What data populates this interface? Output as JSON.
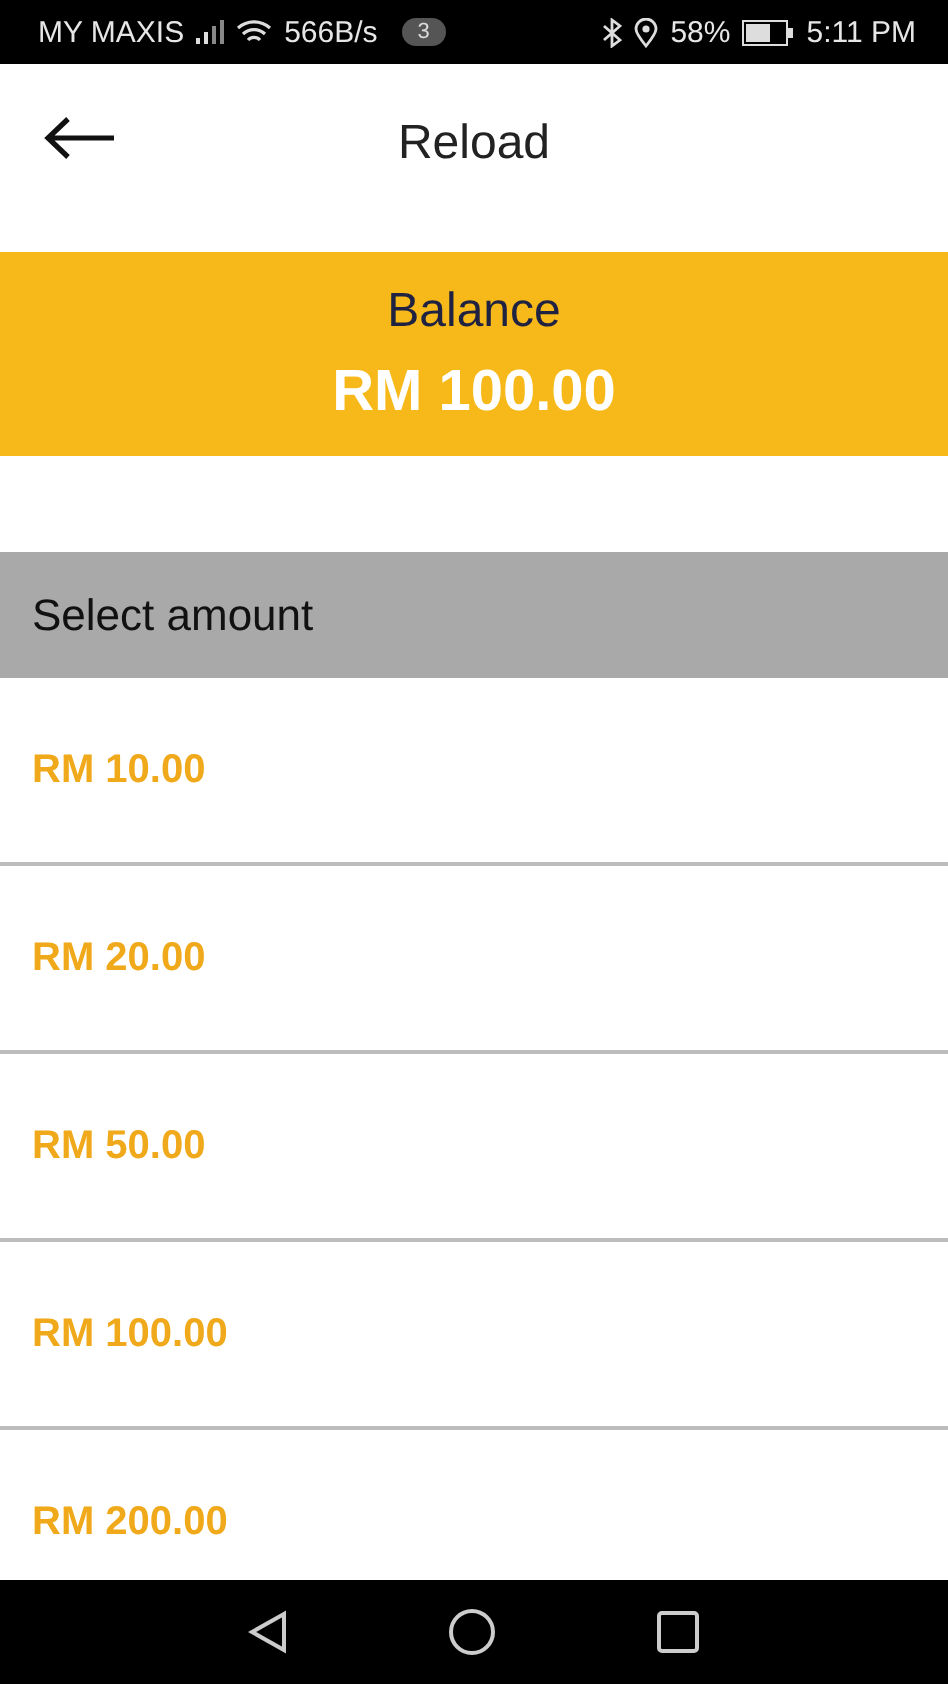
{
  "status_bar": {
    "carrier": "MY MAXIS",
    "speed": "566B/s",
    "notifications": "3",
    "battery": "58%",
    "time": "5:11 PM"
  },
  "header": {
    "title": "Reload"
  },
  "balance": {
    "label": "Balance",
    "amount": "RM 100.00"
  },
  "section": {
    "title": "Select amount"
  },
  "amounts": [
    "RM 10.00",
    "RM 20.00",
    "RM 50.00",
    "RM 100.00",
    "RM 200.00"
  ]
}
